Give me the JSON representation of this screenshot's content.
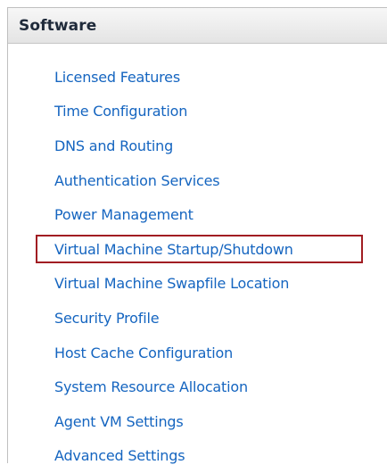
{
  "panel": {
    "title": "Software",
    "items": [
      {
        "label": "Licensed Features"
      },
      {
        "label": "Time Configuration"
      },
      {
        "label": "DNS and Routing"
      },
      {
        "label": "Authentication Services"
      },
      {
        "label": "Power Management"
      },
      {
        "label": "Virtual Machine Startup/Shutdown",
        "highlighted": true
      },
      {
        "label": "Virtual Machine Swapfile Location"
      },
      {
        "label": "Security Profile"
      },
      {
        "label": "Host Cache Configuration"
      },
      {
        "label": "System Resource Allocation"
      },
      {
        "label": "Agent VM Settings"
      },
      {
        "label": "Advanced Settings"
      }
    ]
  },
  "colors": {
    "link": "#1565c0",
    "header_text": "#1f2a3a",
    "highlight_border": "#a11d22"
  }
}
